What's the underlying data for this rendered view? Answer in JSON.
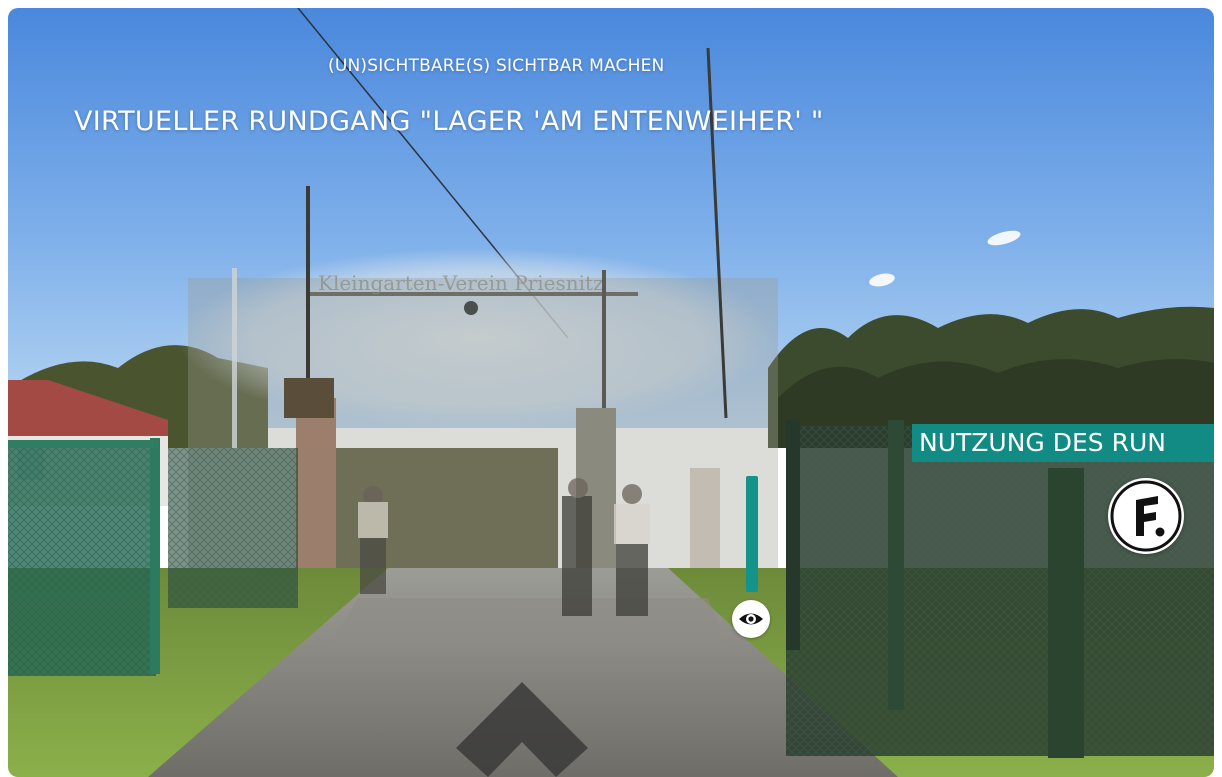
{
  "tour": {
    "subtitle": "(UN)SICHTBARE(S) SICHTBAR MACHEN",
    "title": "VIRTUELLER RUNDGANG \"LAGER 'AM ENTENWEIHER' \""
  },
  "hotspot": {
    "banner_label": "NUTZUNG DES RUN",
    "logo_letter": "F."
  },
  "overlay": {
    "historic_sign_text": "Kleingarten-Verein Priesnitz"
  },
  "colors": {
    "accent": "#118b84",
    "sky_top": "#4f8ee0",
    "sky_bottom": "#a9cdf0"
  },
  "icons": {
    "view_toggle": "eye-icon",
    "navigate": "chevron-up-icon",
    "brand": "logo-f-icon"
  }
}
